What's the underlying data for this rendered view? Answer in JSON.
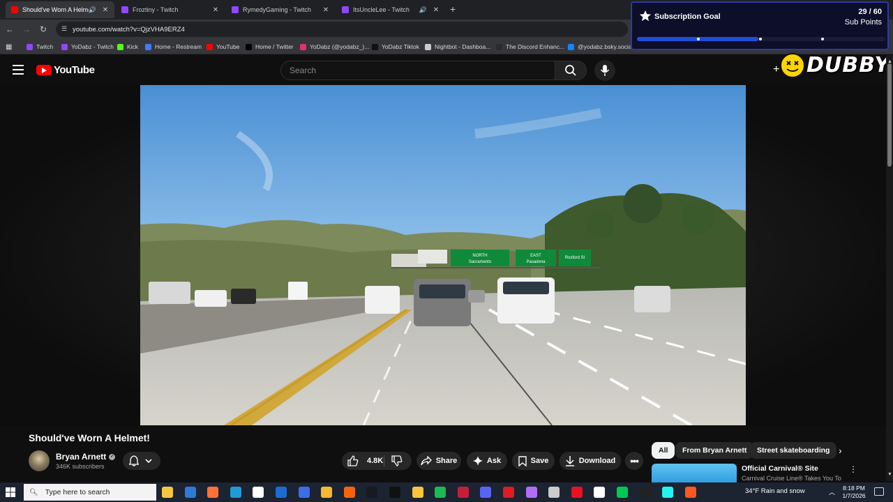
{
  "browser": {
    "tabs": [
      {
        "title": "Should've Worn A Helmet!",
        "active": true,
        "has_audio": true,
        "favicon_color": "#ff0000"
      },
      {
        "title": "Froztiny - Twitch",
        "active": false,
        "has_audio": false,
        "favicon_color": "#9146ff"
      },
      {
        "title": "RymedyGaming - Twitch",
        "active": false,
        "has_audio": false,
        "favicon_color": "#9146ff"
      },
      {
        "title": "ItsUncleLee - Twitch",
        "active": false,
        "has_audio": true,
        "favicon_color": "#9146ff"
      }
    ],
    "new_tab_label": "+",
    "url": "youtube.com/watch?v=QjzVHA9ERZ4",
    "bookmarks": [
      {
        "label": "Twitch",
        "color": "#9146ff"
      },
      {
        "label": "YoDabz - Twitch",
        "color": "#9146ff"
      },
      {
        "label": "Kick",
        "color": "#53fc18"
      },
      {
        "label": "Home - Restream",
        "color": "#3d7bff"
      },
      {
        "label": "YouTube",
        "color": "#ff0000"
      },
      {
        "label": "Home / Twitter",
        "color": "#000000"
      },
      {
        "label": "YoDabz (@yodabz_)...",
        "color": "#e1306c"
      },
      {
        "label": "YoDabz Tiktok",
        "color": "#111111"
      },
      {
        "label": "Nightbot - Dashboa...",
        "color": "#cccccc"
      },
      {
        "label": "The Discord Enhanc...",
        "color": "#2b2b2b"
      },
      {
        "label": "@yodabz.bsky.socia...",
        "color": "#1185fe"
      }
    ]
  },
  "overlay": {
    "goal_title": "Subscription Goal",
    "goal_count": "29 / 60",
    "goal_unit": "Sub Points",
    "goal_progress": 0.49,
    "dubby_text": "DUBBY"
  },
  "youtube": {
    "logo_text": "YouTube",
    "search_placeholder": "Search",
    "video_title": "Should've Worn A Helmet!",
    "channel_name": "Bryan Arnett",
    "subscribers": "346K subscribers",
    "like_count": "4.8K",
    "actions": {
      "share": "Share",
      "ask": "Ask",
      "save": "Save",
      "download": "Download"
    },
    "chips": [
      "All",
      "From Bryan Arnett",
      "Street skateboarding"
    ],
    "ad": {
      "title": "Official Carnival® Site",
      "subtitle": "Carnival Cruise Line® Takes You To"
    },
    "video_signs": {
      "sign1": "NORTH",
      "sign1_sub": "Sacramento",
      "sign2": "EAST",
      "sign2_sub": "Pasadena",
      "sign3": "Roxford St"
    }
  },
  "taskbar": {
    "search_placeholder": "Type here to search",
    "weather": "34°F  Rain and snow",
    "time": "8:18 PM",
    "date": "1/7/2026",
    "app_colors": [
      "#f5c542",
      "#2e7bd6",
      "#ff7139",
      "#1f9bd8",
      "#ffffff",
      "#1e6bd6",
      "#3d6ee8",
      "#f5b82e",
      "#f7630c",
      "#171a21",
      "#111111",
      "#f9c43b",
      "#1db954",
      "#c41e3a",
      "#5865f2",
      "#e01b24",
      "#b16ef3",
      "#cccccc",
      "#e81123",
      "#ffffff",
      "#00c853",
      "#222222",
      "#25f4ee",
      "#ff5722"
    ]
  }
}
